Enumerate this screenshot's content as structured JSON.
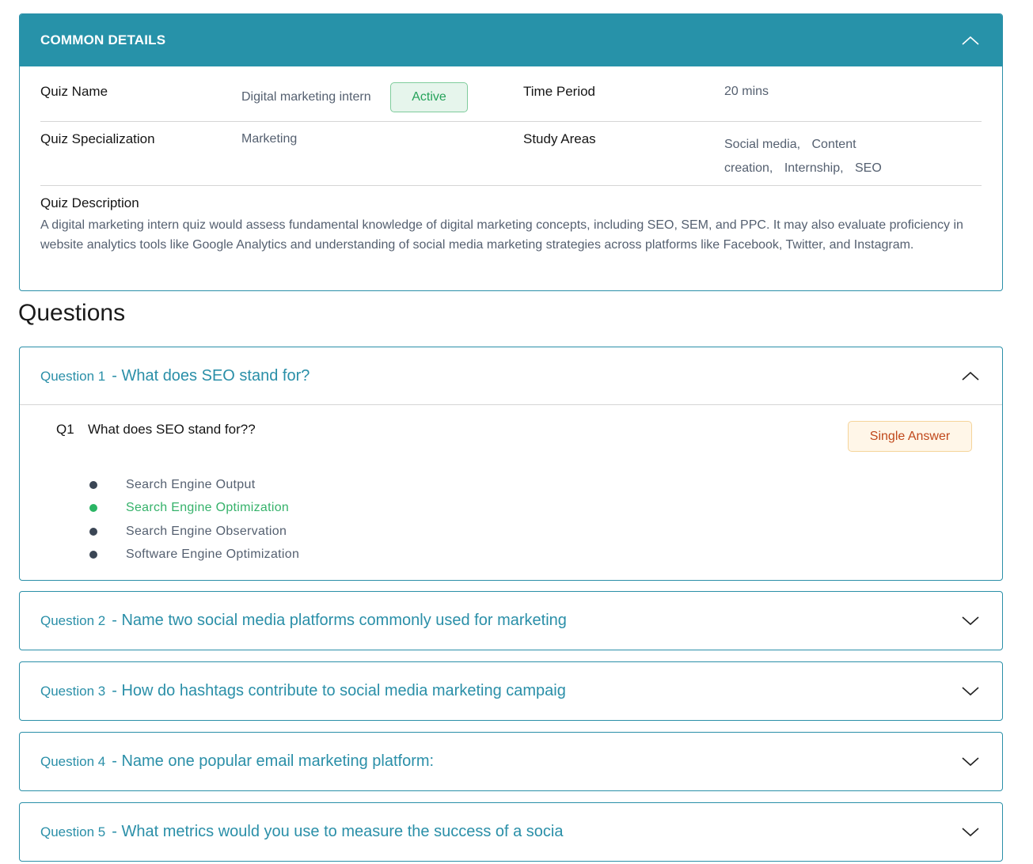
{
  "common_details": {
    "title": "COMMON DETAILS",
    "quiz_name_label": "Quiz Name",
    "quiz_name_value": "Digital marketing intern",
    "status": "Active",
    "time_period_label": "Time Period",
    "time_period_value": "20 mins",
    "specialization_label": "Quiz Specialization",
    "specialization_value": "Marketing",
    "study_areas_label": "Study Areas",
    "study_areas": [
      "Social media,",
      "Content creation,",
      "Internship,",
      "SEO"
    ],
    "description_label": "Quiz Description",
    "description": "A digital marketing intern quiz would assess fundamental knowledge of digital marketing concepts, including SEO, SEM, and PPC. It may also evaluate proficiency in website analytics tools like Google Analytics and understanding of social media marketing strategies across platforms like Facebook, Twitter, and Instagram."
  },
  "questions_title": "Questions",
  "questions": [
    {
      "num_label": "Question 1",
      "title": "- What does SEO stand for?",
      "expanded": true,
      "code": "Q1",
      "text": "What does SEO stand for??",
      "type": "Single Answer",
      "options": [
        {
          "label": "Search Engine Output",
          "correct": false
        },
        {
          "label": "Search Engine Optimization",
          "correct": true
        },
        {
          "label": "Search Engine Observation",
          "correct": false
        },
        {
          "label": "Software Engine Optimization",
          "correct": false
        }
      ]
    },
    {
      "num_label": "Question 2",
      "title": "- Name two social media platforms commonly used for marketing",
      "expanded": false
    },
    {
      "num_label": "Question 3",
      "title": "- How do hashtags contribute to social media marketing campaig",
      "expanded": false
    },
    {
      "num_label": "Question 4",
      "title": "- Name one popular email marketing platform:",
      "expanded": false
    },
    {
      "num_label": "Question 5",
      "title": "- What metrics would you use to measure the success of a socia",
      "expanded": false
    }
  ],
  "icons": {
    "collapse": "chevron-up-icon",
    "expand": "chevron-down-icon",
    "bullet": "bullet-icon"
  },
  "colors": {
    "accent": "#2792a9",
    "active_green": "#25a25a",
    "single_answer_orange": "#c0481b"
  }
}
